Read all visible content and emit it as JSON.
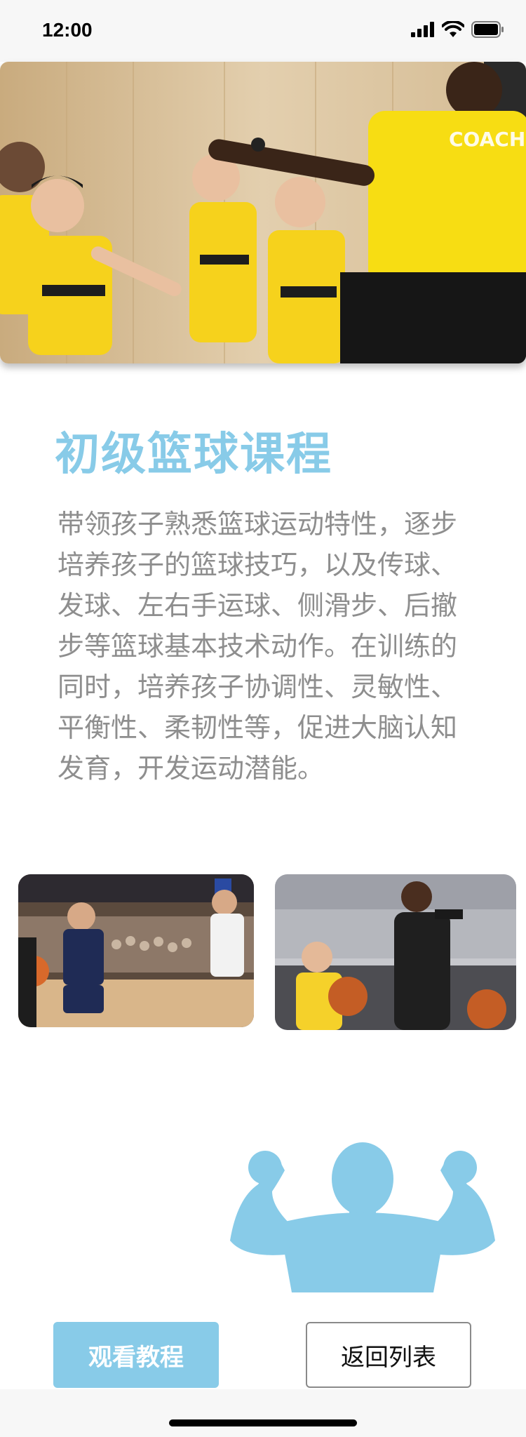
{
  "status_bar": {
    "time": "12:00"
  },
  "course": {
    "title": "初级篮球课程",
    "description": "带领孩子熟悉篮球运动特性，逐步培养孩子的篮球技巧，以及传球、发球、左右手运球、侧滑步、后撤步等篮球基本技术动作。在训练的同时，培养孩子协调性、灵敏性、平衡性、柔韧性等，促进大脑认知发育，开发运动潜能。"
  },
  "actions": {
    "watch_label": "观看教程",
    "back_label": "返回列表"
  },
  "colors": {
    "accent": "#88cbe8",
    "body_text": "#8e8e8e"
  }
}
